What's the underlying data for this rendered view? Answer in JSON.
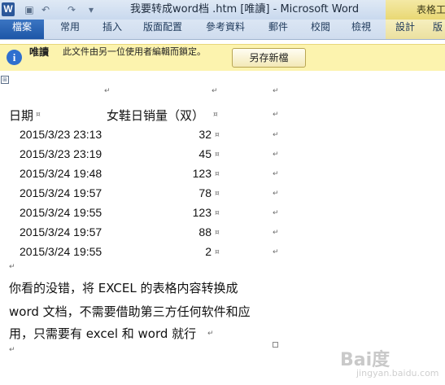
{
  "titlebar": {
    "app_icon": "W",
    "qat_save": "▣",
    "qat_undo": "↶",
    "qat_redo": "↷",
    "qat_customize": "▾",
    "title": "我要转成word档 .htm [唯讀] - Microsoft Word",
    "tool_group": "表格工"
  },
  "ribbon": {
    "tabs": [
      "檔案",
      "常用",
      "插入",
      "版面配置",
      "參考資料",
      "郵件",
      "校閱",
      "檢視",
      "設計",
      "版"
    ]
  },
  "message_bar": {
    "icon": "i",
    "title": "唯讀",
    "text": "此文件由另一位使用者編輯而鎖定。",
    "button_label": "另存新檔"
  },
  "document": {
    "table_anchor_icon": "⊞",
    "table": {
      "headers": [
        "日期",
        "女鞋日销量（双）"
      ],
      "rows": [
        {
          "date": "2015/3/23 23:13",
          "qty": "32"
        },
        {
          "date": "2015/3/23 23:19",
          "qty": "45"
        },
        {
          "date": "2015/3/24 19:48",
          "qty": "123"
        },
        {
          "date": "2015/3/24 19:57",
          "qty": "78"
        },
        {
          "date": "2015/3/24 19:55",
          "qty": "123"
        },
        {
          "date": "2015/3/24 19:57",
          "qty": "88"
        },
        {
          "date": "2015/3/24 19:55",
          "qty": "2"
        }
      ]
    },
    "paragraph_lines": [
      "你看的没错，将 EXCEL 的表格内容转换成",
      "word 文档，不需要借助第三方任何软件和应",
      "用，只需要有 excel 和 word 就行"
    ],
    "paragraph_mark": "↵",
    "cell_mark": "¤"
  },
  "watermark": {
    "text": "Bai度",
    "sub": "jingyan.baidu.com"
  }
}
